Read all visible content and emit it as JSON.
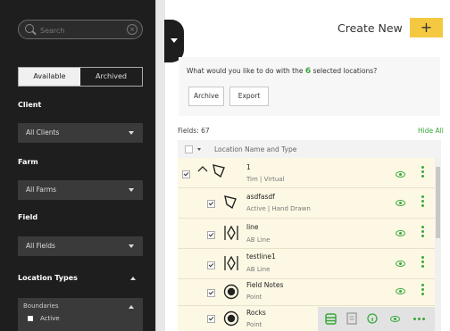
{
  "sidebar": {
    "search": {
      "placeholder": "Search"
    },
    "tabs": {
      "available": "Available",
      "archived": "Archived"
    },
    "client": {
      "label": "Client",
      "value": "All Clients"
    },
    "farm": {
      "label": "Farm",
      "value": "All Farms"
    },
    "field": {
      "label": "Field",
      "value": "All Fields"
    },
    "location_types": {
      "label": "Location Types"
    },
    "boundaries": {
      "label": "Boundaries",
      "item": "Active"
    }
  },
  "header": {
    "create_label": "Create New",
    "plus": "+"
  },
  "prompt": {
    "before": "What would you like to do with the",
    "count": "6",
    "after": "selected locations?",
    "archive": "Archive",
    "export": "Export"
  },
  "list": {
    "fields_count": "Fields: 67",
    "hide_all": "Hide All",
    "column_header": "Location Name and Type",
    "rows": [
      {
        "name": "1",
        "subtitle": "Tim | Virtual"
      },
      {
        "name": "asdfasdf",
        "subtitle": "Active | Hand Drawn"
      },
      {
        "name": "line",
        "subtitle": "AB Line"
      },
      {
        "name": "testline1",
        "subtitle": "AB Line"
      },
      {
        "name": "Field Notes",
        "subtitle": "Point"
      },
      {
        "name": "Rocks",
        "subtitle": "Point"
      }
    ]
  },
  "colors": {
    "accent": "#39a83b",
    "create_button": "#f5c842",
    "sidebar_bg": "#1e1e1e",
    "selected_row": "#fdf8e4"
  },
  "icons": {
    "row_1_expand": "chevron-up-icon",
    "polygon": "polygon-icon",
    "ab_line": "ab-line-icon",
    "point": "point-icon",
    "visibility": "eye-icon",
    "menu": "kebab-menu-icon"
  }
}
